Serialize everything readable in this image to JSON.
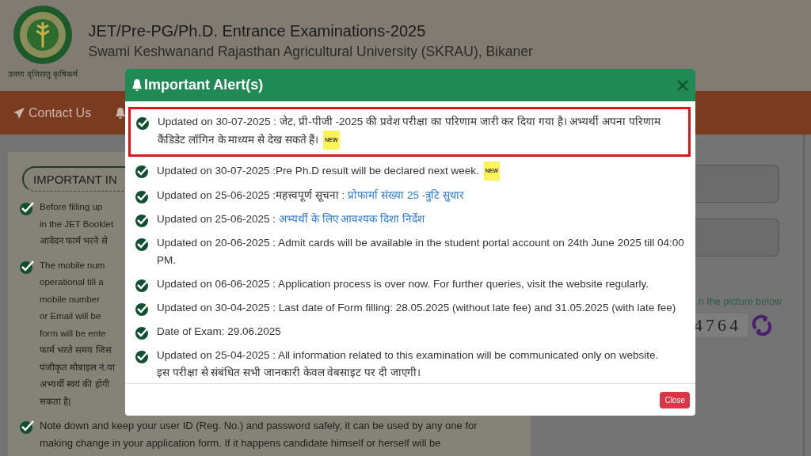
{
  "header": {
    "motto": "उत्तमा वृत्तिरस्तु कृषिकर्मं",
    "title": "JET/Pre-PG/Ph.D. Entrance Examinations-2025",
    "subtitle": "Swami Keshwanand Rajasthan Agricultural University (SKRAU), Bikaner"
  },
  "nav": {
    "items": [
      {
        "label": "Contact Us"
      }
    ]
  },
  "info_panel": {
    "heading": "IMPORTANT IN",
    "bullets": [
      {
        "lines": [
          "Before filling up",
          "in the JET Booklet",
          "आवेदन फार्म भरने से"
        ]
      },
      {
        "lines": [
          "The mobile num",
          "operational till a",
          "mobile number",
          "or Email will be",
          "form will be ente",
          "फार्म भरते समय जिस",
          "पंजीकृत मोबाइल नं.या",
          "अभ्यर्थी स्वयं की होगी",
          "सकता है|"
        ]
      },
      {
        "lines": [
          "Note down and keep your user ID (Reg. No.) and password safely, it can be used by any one for",
          "making change in your application form. If it happens candidate himself or herself will be"
        ]
      }
    ]
  },
  "login_panel": {
    "captcha_hint": "n the picture below",
    "captcha": "4764"
  },
  "modal": {
    "title": "Important Alert(s)",
    "close_button": "Close",
    "alerts": [
      {
        "text": "Updated on 30-07-2025 : जेट, प्री-पीजी -2025 की प्रवेश परीक्षा का परिणाम जारी कर दिया गया है। अभ्यर्थी अपना परिणाम कैंडिडेट लॉगिन के माध्यम से देख सकते हैं।",
        "badge": "NEW",
        "highlighted": true
      },
      {
        "text": "Updated on 30-07-2025 :Pre Ph.D result will be declared next week.",
        "badge": "NEW",
        "highlighted": false
      },
      {
        "text": "Updated on 25-06-2025 :महत्त्वपूर्ण सूचना :",
        "link": "प्रोफार्मा संख्या 25 -त्रुटि सुधार",
        "highlighted": false
      },
      {
        "text": "Updated on 25-06-2025 :",
        "link": "अभ्यर्थी के लिए आवश्यक दिशा निर्देश",
        "highlighted": false
      },
      {
        "text": "Updated on 20-06-2025 : Admit cards will be available in the student portal account on 24th June 2025 till 04:00 PM.",
        "highlighted": false
      },
      {
        "text": "Updated on 06-06-2025 : Application process is over now. For further queries, visit the website regularly.",
        "highlighted": false
      },
      {
        "text": "Updated on 30-04-2025 : Last date of Form filling: 28.05.2025 (without late fee) and 31.05.2025 (with late fee)",
        "highlighted": false
      },
      {
        "text": "Date of Exam: 29.06.2025",
        "highlighted": false
      },
      {
        "text": "Updated on 25-04-2025 : All information related to this examination will be communicated only on website.",
        "note": "इस परीक्षा से संबंधित सभी जानकारी केवल वेबसाइट पर दी जाएगी।",
        "highlighted": false
      }
    ]
  }
}
